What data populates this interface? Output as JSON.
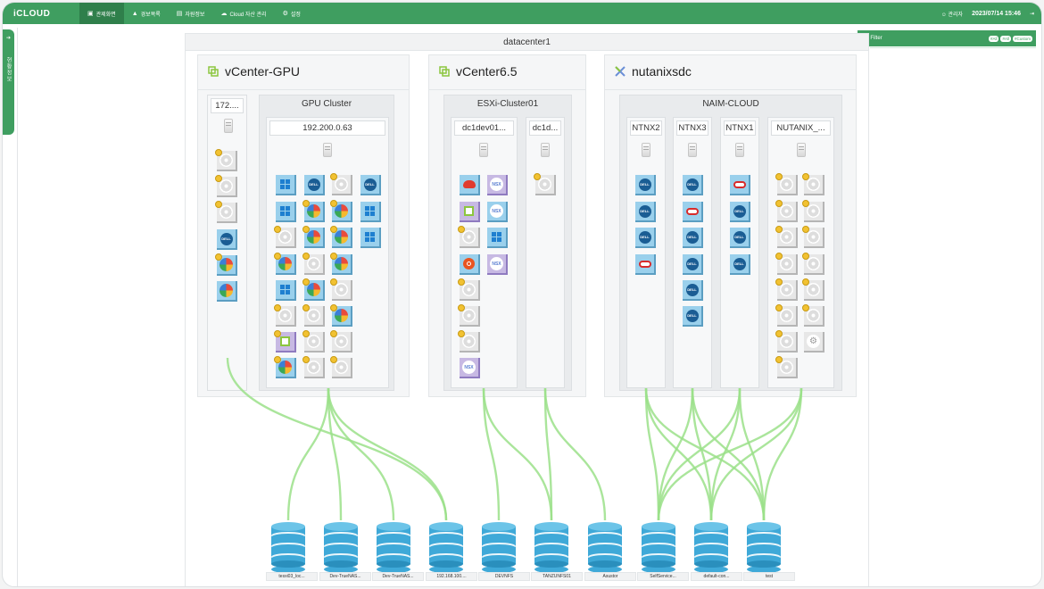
{
  "app": {
    "logo": "iCLOUD"
  },
  "nav": {
    "items": [
      {
        "label": "관제화면",
        "icon": "monitor-icon",
        "active": true
      },
      {
        "label": "경보목록",
        "icon": "warning-icon",
        "active": false
      },
      {
        "label": "자원정보",
        "icon": "document-icon",
        "active": false
      },
      {
        "label": "Cloud 자산 관리",
        "icon": "cloud-icon",
        "active": false
      },
      {
        "label": "설정",
        "icon": "gear-icon",
        "active": false
      }
    ]
  },
  "topbar": {
    "user": "관리자",
    "datetime": "2023/07/14 15:46",
    "user_icon": "user-icon",
    "logout_icon": "logout-icon"
  },
  "side_panel": {
    "label": "현황정보",
    "toggle_icon": "chevron-right-icon"
  },
  "filter": {
    "label": "Filter",
    "chips": [
      "#All",
      "#All",
      "#Custom"
    ]
  },
  "datacenter": {
    "title": "datacenter1"
  },
  "vcenters": [
    {
      "name": "vCenter-GPU",
      "icon": "vsphere-icon",
      "standalone_host": "172....",
      "cluster": {
        "name": "GPU Cluster",
        "hosts": [
          "192.200.0.63"
        ]
      }
    },
    {
      "name": "vCenter6.5",
      "icon": "vsphere-icon",
      "cluster": {
        "name": "ESXi-Cluster01",
        "hosts": [
          "dc1dev01...",
          "dc1d..."
        ]
      }
    },
    {
      "name": "nutanixsdc",
      "icon": "nutanix-icon",
      "cluster": {
        "name": "NAIM-CLOUD",
        "hosts": [
          "NTNX2",
          "NTNX3",
          "NTNX1",
          "NUTANIX_..."
        ]
      }
    }
  ],
  "datastores": [
    "tesxi03_loc...",
    "Dev-TrueNAS...",
    "Dev-TrueNAS...",
    "192.168.100....",
    "DEVNFS",
    "TANZUNFS01",
    "Asustor",
    "SelfService...",
    "default-con...",
    "test"
  ],
  "colors": {
    "accent": "#3f9e60",
    "accent_dark": "#2f7f4b",
    "link_line": "#9be08a",
    "storage": "#3fa9d8"
  }
}
